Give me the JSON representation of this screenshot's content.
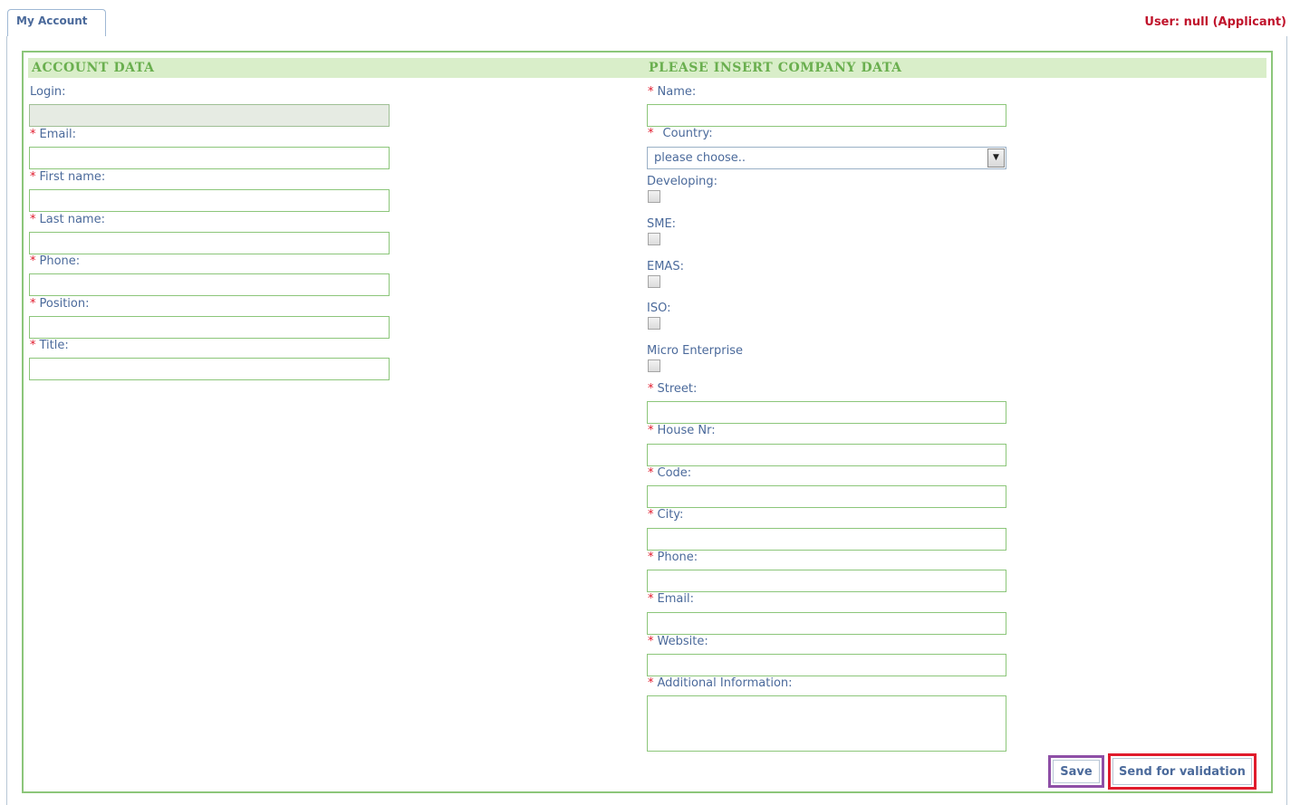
{
  "tab": {
    "label": "My Account"
  },
  "user_info": "User: null (Applicant)",
  "account": {
    "section_title": "ACCOUNT DATA",
    "fields": [
      {
        "label": "Login:",
        "required": false,
        "value": ""
      },
      {
        "label": "Email:",
        "required": true,
        "value": ""
      },
      {
        "label": "First name:",
        "required": true,
        "value": ""
      },
      {
        "label": "Last name:",
        "required": true,
        "value": ""
      },
      {
        "label": "Phone:",
        "required": true,
        "value": ""
      },
      {
        "label": "Position:",
        "required": true,
        "value": ""
      },
      {
        "label": "Title:",
        "required": true,
        "value": ""
      }
    ]
  },
  "company": {
    "section_title": "PLEASE INSERT COMPANY DATA",
    "name_label": "Name:",
    "country_label": "Country:",
    "country_selected": "please choose..",
    "checkboxes": [
      {
        "label": "Developing:",
        "checked": false
      },
      {
        "label": "SME:",
        "checked": false
      },
      {
        "label": "EMAS:",
        "checked": false
      },
      {
        "label": "ISO:",
        "checked": false
      },
      {
        "label": "Micro Enterprise",
        "checked": false
      }
    ],
    "address_fields": [
      {
        "label": "Street:",
        "required": true
      },
      {
        "label": "House Nr:",
        "required": true
      },
      {
        "label": "Code:",
        "required": true
      },
      {
        "label": "City:",
        "required": true
      },
      {
        "label": "Phone:",
        "required": true
      },
      {
        "label": "Email:",
        "required": true
      },
      {
        "label": "Website:",
        "required": true
      }
    ],
    "additional_label": "Additional Information:"
  },
  "required_marker": "*",
  "buttons": {
    "save": "Save",
    "send": "Send for validation"
  },
  "colors": {
    "accent_green": "#8cc67a",
    "header_green": "#6aaf4f",
    "text_blue": "#4b6a9b",
    "required_red": "#e0192c",
    "highlight_save": "#8e4fa6",
    "highlight_send": "#e01b2c"
  }
}
